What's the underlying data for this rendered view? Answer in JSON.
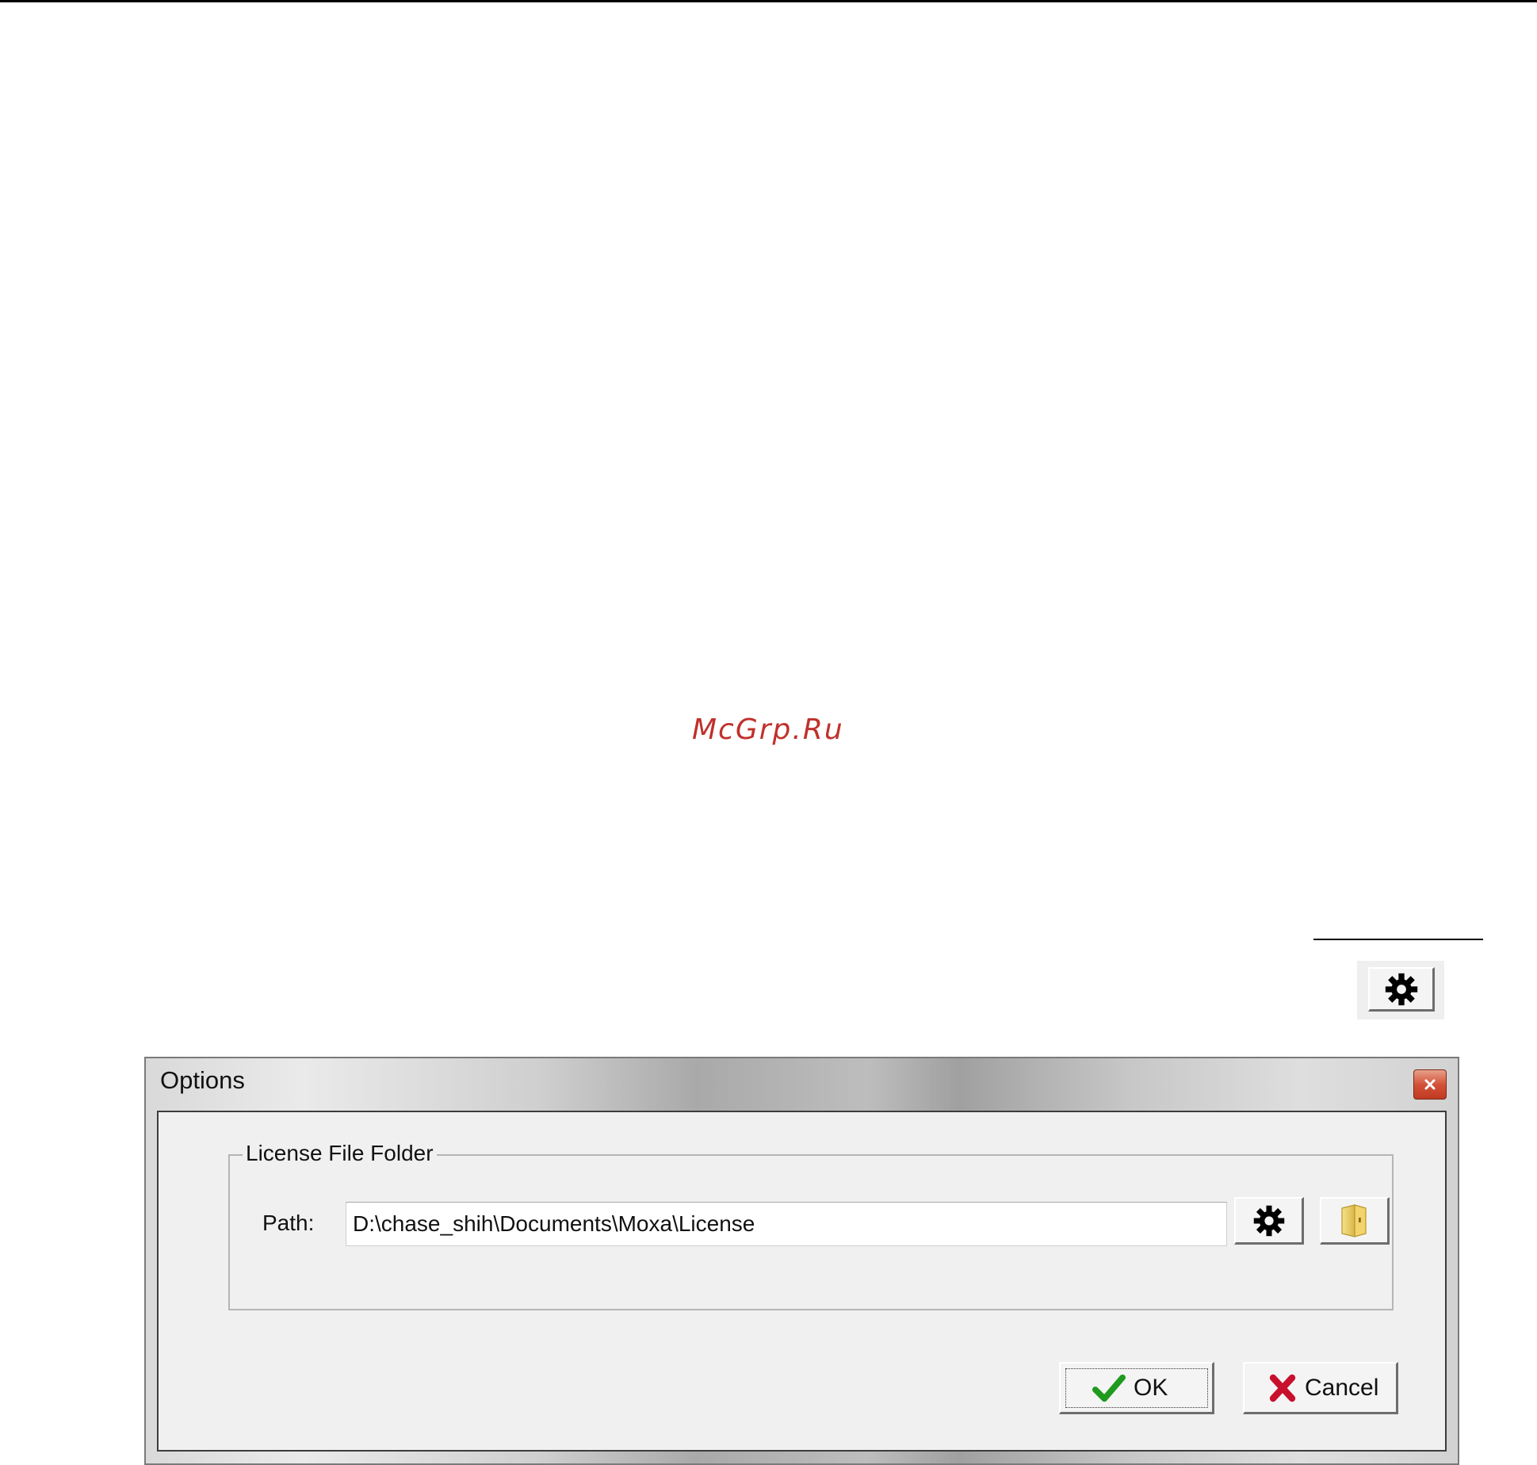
{
  "watermark": {
    "text": "McGrp.Ru",
    "color": "#c0312b"
  },
  "toolbar": {
    "gear_icon": "gear-icon"
  },
  "dialog": {
    "title": "Options",
    "close_icon": "close-icon",
    "group": {
      "legend": "License File Folder",
      "path_label": "Path:",
      "path_value": "D:\\chase_shih\\Documents\\Moxa\\License",
      "gear_icon": "gear-icon",
      "folder_icon": "folder-icon"
    },
    "buttons": {
      "ok_label": "OK",
      "ok_icon": "checkmark-icon",
      "cancel_label": "Cancel",
      "cancel_icon": "x-mark-icon"
    },
    "colors": {
      "ok_check": "#1f9a1f",
      "cancel_x": "#c8102e",
      "close_button": "#d3533a"
    }
  }
}
